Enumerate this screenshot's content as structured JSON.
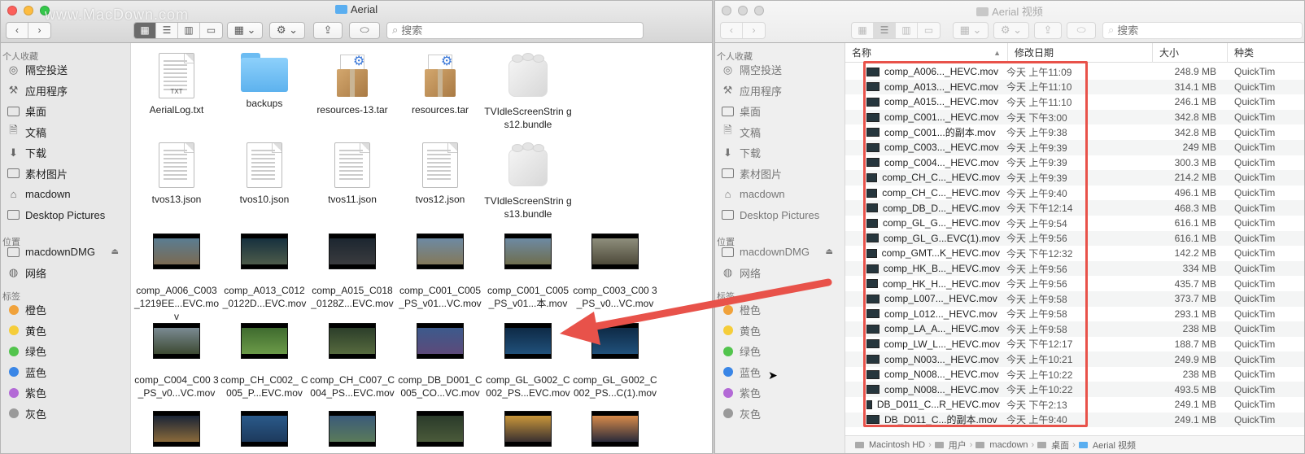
{
  "watermark": "www.MacDown.com",
  "colors": {
    "accent_red": "#e8524a",
    "folder_blue": "#5aaef0"
  },
  "left_window": {
    "title": "Aerial",
    "search_placeholder": "搜索",
    "sidebar": {
      "favorites_header": "个人收藏",
      "favorites": [
        {
          "label": "隔空投送",
          "icon": "airdrop-icon",
          "glyph": "◎"
        },
        {
          "label": "应用程序",
          "icon": "applications-icon",
          "glyph": "⚒"
        },
        {
          "label": "桌面",
          "icon": "desktop-icon",
          "glyph": ""
        },
        {
          "label": "文稿",
          "icon": "documents-icon",
          "glyph": "🗎"
        },
        {
          "label": "下载",
          "icon": "downloads-icon",
          "glyph": "⬇"
        },
        {
          "label": "素材图片",
          "icon": "folder-icon",
          "glyph": ""
        },
        {
          "label": "macdown",
          "icon": "home-icon",
          "glyph": "⌂"
        },
        {
          "label": "Desktop Pictures",
          "icon": "folder-icon",
          "glyph": ""
        }
      ],
      "locations_header": "位置",
      "locations": [
        {
          "label": "macdownDMG",
          "icon": "disk-icon",
          "glyph": ""
        },
        {
          "label": "网络",
          "icon": "network-icon",
          "glyph": "◍"
        }
      ],
      "tags_header": "标签",
      "tags": [
        {
          "label": "橙色",
          "color": "#f0a23b"
        },
        {
          "label": "黄色",
          "color": "#f5cd3a"
        },
        {
          "label": "绿色",
          "color": "#52c44d"
        },
        {
          "label": "蓝色",
          "color": "#3a86e6"
        },
        {
          "label": "紫色",
          "color": "#b36ad6"
        },
        {
          "label": "灰色",
          "color": "#9a9a9a"
        }
      ]
    },
    "files": [
      {
        "name": "AerialLog.txt",
        "kind": "txt",
        "ext_label": "TXT"
      },
      {
        "name": "backups",
        "kind": "folder"
      },
      {
        "name": "resources-13.tar",
        "kind": "pkg"
      },
      {
        "name": "resources.tar",
        "kind": "pkg"
      },
      {
        "name": "TVIdleScreenStrin gs12.bundle",
        "kind": "bundle"
      },
      {
        "name": "tvos13.json",
        "kind": "json"
      },
      {
        "name": "tvos10.json",
        "kind": "json"
      },
      {
        "name": "tvos11.json",
        "kind": "json"
      },
      {
        "name": "tvos12.json",
        "kind": "json"
      },
      {
        "name": "TVIdleScreenStrin gs13.bundle",
        "kind": "bundle"
      },
      {
        "name": "comp_A006_C003 _1219EE...EVC.mov",
        "kind": "video",
        "tone": "#5a7d92,#7b6a52"
      },
      {
        "name": "comp_A013_C012 _0122D...EVC.mov",
        "kind": "video",
        "tone": "#16303e,#4d5b4a"
      },
      {
        "name": "comp_A015_C018 _0128Z...EVC.mov",
        "kind": "video",
        "tone": "#1c2630,#3a3b3e"
      },
      {
        "name": "comp_C001_C005 _PS_v01...VC.mov",
        "kind": "video",
        "tone": "#6d8aa3,#84795a"
      },
      {
        "name": "comp_C001_C005 _PS_v01...本.mov",
        "kind": "video",
        "tone": "#6d8aa3,#6f6e4e"
      },
      {
        "name": "comp_C003_C00 3_PS_v0...VC.mov",
        "kind": "video",
        "tone": "#8e8e7c,#4e4a3a"
      },
      {
        "name": "comp_C004_C00 3_PS_v0...VC.mov",
        "kind": "video",
        "tone": "#7a8a92,#3d4a32"
      },
      {
        "name": "comp_CH_C002_ C005_P...EVC.mov",
        "kind": "video",
        "tone": "#3f6b2f,#6b9a48"
      },
      {
        "name": "comp_CH_C007_C 004_PS...EVC.mov",
        "kind": "video",
        "tone": "#2c3e2a,#566a3e"
      },
      {
        "name": "comp_DB_D001_C 005_CO...VC.mov",
        "kind": "video",
        "tone": "#3d5a8c,#5c4a7a"
      },
      {
        "name": "comp_GL_G002_C 002_PS...EVC.mov",
        "kind": "video",
        "tone": "#0e2a46,#20507a"
      },
      {
        "name": "comp_GL_G002_C 002_PS...C(1).mov",
        "kind": "video",
        "tone": "#0e2a46,#20507a"
      },
      {
        "name": "",
        "kind": "video",
        "tone": "#1a2436,#8a6a3a"
      },
      {
        "name": "",
        "kind": "video",
        "tone": "#2a5a8a,#1d3a5c"
      },
      {
        "name": "",
        "kind": "video",
        "tone": "#3a5a7a,#5a7a5a"
      },
      {
        "name": "",
        "kind": "video",
        "tone": "#2a3a2a,#4a5a3a"
      },
      {
        "name": "",
        "kind": "video",
        "tone": "#c9963a,#3a3030"
      },
      {
        "name": "",
        "kind": "video",
        "tone": "#d88a4a,#2a2a3a"
      }
    ]
  },
  "right_window": {
    "title": "Aerial 视频",
    "search_placeholder": "搜索",
    "sidebar": {
      "favorites_header": "个人收藏",
      "favorites": [
        {
          "label": "隔空投送",
          "icon": "airdrop-icon",
          "glyph": "◎"
        },
        {
          "label": "应用程序",
          "icon": "applications-icon",
          "glyph": "⚒"
        },
        {
          "label": "桌面",
          "icon": "desktop-icon",
          "glyph": ""
        },
        {
          "label": "文稿",
          "icon": "documents-icon",
          "glyph": "🗎"
        },
        {
          "label": "下载",
          "icon": "downloads-icon",
          "glyph": "⬇"
        },
        {
          "label": "素材图片",
          "icon": "folder-icon",
          "glyph": ""
        },
        {
          "label": "macdown",
          "icon": "home-icon",
          "glyph": "⌂"
        },
        {
          "label": "Desktop Pictures",
          "icon": "folder-icon",
          "glyph": ""
        }
      ],
      "locations_header": "位置",
      "locations": [
        {
          "label": "macdownDMG",
          "icon": "disk-icon",
          "glyph": ""
        },
        {
          "label": "网络",
          "icon": "network-icon",
          "glyph": "◍"
        }
      ],
      "tags_header": "标签",
      "tags": [
        {
          "label": "橙色",
          "color": "#f0a23b"
        },
        {
          "label": "黄色",
          "color": "#f5cd3a"
        },
        {
          "label": "绿色",
          "color": "#52c44d"
        },
        {
          "label": "蓝色",
          "color": "#3a86e6"
        },
        {
          "label": "紫色",
          "color": "#b36ad6"
        },
        {
          "label": "灰色",
          "color": "#9a9a9a"
        }
      ]
    },
    "columns": {
      "name": "名称",
      "date": "修改日期",
      "size": "大小",
      "kind": "种类"
    },
    "rows": [
      {
        "name": "comp_A006..._HEVC.mov",
        "date": "今天 上午11:09",
        "size": "248.9 MB",
        "kind": "QuickTim"
      },
      {
        "name": "comp_A013..._HEVC.mov",
        "date": "今天 上午11:10",
        "size": "314.1 MB",
        "kind": "QuickTim"
      },
      {
        "name": "comp_A015..._HEVC.mov",
        "date": "今天 上午11:10",
        "size": "246.1 MB",
        "kind": "QuickTim"
      },
      {
        "name": "comp_C001..._HEVC.mov",
        "date": "今天 下午3:00",
        "size": "342.8 MB",
        "kind": "QuickTim"
      },
      {
        "name": "comp_C001...的副本.mov",
        "date": "今天 上午9:38",
        "size": "342.8 MB",
        "kind": "QuickTim"
      },
      {
        "name": "comp_C003..._HEVC.mov",
        "date": "今天 上午9:39",
        "size": "249 MB",
        "kind": "QuickTim"
      },
      {
        "name": "comp_C004..._HEVC.mov",
        "date": "今天 上午9:39",
        "size": "300.3 MB",
        "kind": "QuickTim"
      },
      {
        "name": "comp_CH_C..._HEVC.mov",
        "date": "今天 上午9:39",
        "size": "214.2 MB",
        "kind": "QuickTim"
      },
      {
        "name": "comp_CH_C..._HEVC.mov",
        "date": "今天 上午9:40",
        "size": "496.1 MB",
        "kind": "QuickTim"
      },
      {
        "name": "comp_DB_D..._HEVC.mov",
        "date": "今天 下午12:14",
        "size": "468.3 MB",
        "kind": "QuickTim"
      },
      {
        "name": "comp_GL_G..._HEVC.mov",
        "date": "今天 上午9:54",
        "size": "616.1 MB",
        "kind": "QuickTim"
      },
      {
        "name": "comp_GL_G...EVC(1).mov",
        "date": "今天 上午9:56",
        "size": "616.1 MB",
        "kind": "QuickTim"
      },
      {
        "name": "comp_GMT...K_HEVC.mov",
        "date": "今天 下午12:32",
        "size": "142.2 MB",
        "kind": "QuickTim"
      },
      {
        "name": "comp_HK_B..._HEVC.mov",
        "date": "今天 上午9:56",
        "size": "334 MB",
        "kind": "QuickTim"
      },
      {
        "name": "comp_HK_H..._HEVC.mov",
        "date": "今天 上午9:56",
        "size": "435.7 MB",
        "kind": "QuickTim"
      },
      {
        "name": "comp_L007..._HEVC.mov",
        "date": "今天 上午9:58",
        "size": "373.7 MB",
        "kind": "QuickTim"
      },
      {
        "name": "comp_L012..._HEVC.mov",
        "date": "今天 上午9:58",
        "size": "293.1 MB",
        "kind": "QuickTim"
      },
      {
        "name": "comp_LA_A..._HEVC.mov",
        "date": "今天 上午9:58",
        "size": "238 MB",
        "kind": "QuickTim"
      },
      {
        "name": "comp_LW_L..._HEVC.mov",
        "date": "今天 下午12:17",
        "size": "188.7 MB",
        "kind": "QuickTim"
      },
      {
        "name": "comp_N003..._HEVC.mov",
        "date": "今天 上午10:21",
        "size": "249.9 MB",
        "kind": "QuickTim"
      },
      {
        "name": "comp_N008..._HEVC.mov",
        "date": "今天 上午10:22",
        "size": "238 MB",
        "kind": "QuickTim"
      },
      {
        "name": "comp_N008..._HEVC.mov",
        "date": "今天 上午10:22",
        "size": "493.5 MB",
        "kind": "QuickTim"
      },
      {
        "name": "DB_D011_C...R_HEVC.mov",
        "date": "今天 下午2:13",
        "size": "249.1 MB",
        "kind": "QuickTim"
      },
      {
        "name": "DB_D011_C...的副本.mov",
        "date": "今天 上午9:40",
        "size": "249.1 MB",
        "kind": "QuickTim"
      }
    ],
    "path": [
      "Macintosh HD",
      "用户",
      "macdown",
      "桌面",
      "Aerial 视频"
    ]
  }
}
